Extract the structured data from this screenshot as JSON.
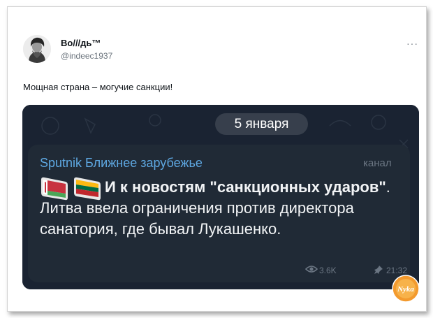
{
  "tweet": {
    "author_name": "Во///дь™",
    "author_handle": "@indeec1937",
    "more_icon": "ellipsis-icon",
    "text": "Мощная страна – могучие санкции!"
  },
  "telegram_post": {
    "date_label": "5 января",
    "channel_name": "Sputnik Ближнее зарубежье",
    "channel_tag": "канал",
    "flags": [
      "belarus-flag-icon",
      "lithuania-flag-icon"
    ],
    "headline_bold": "И к новостям \"санкционных ударов\"",
    "headline_rest": ". Литва ввела ограничения против директора санатория, где бывал Лукашенко.",
    "views": "3.6K",
    "time": "21:32",
    "colors": {
      "card_bg": "#1a2332",
      "bubble_bg": "#202a36",
      "channel_name": "#5ea8e2",
      "meta": "#6b7683"
    }
  },
  "watermark": {
    "logo_text": "Nyka",
    "colors": {
      "fill": "#f39a2e"
    }
  }
}
